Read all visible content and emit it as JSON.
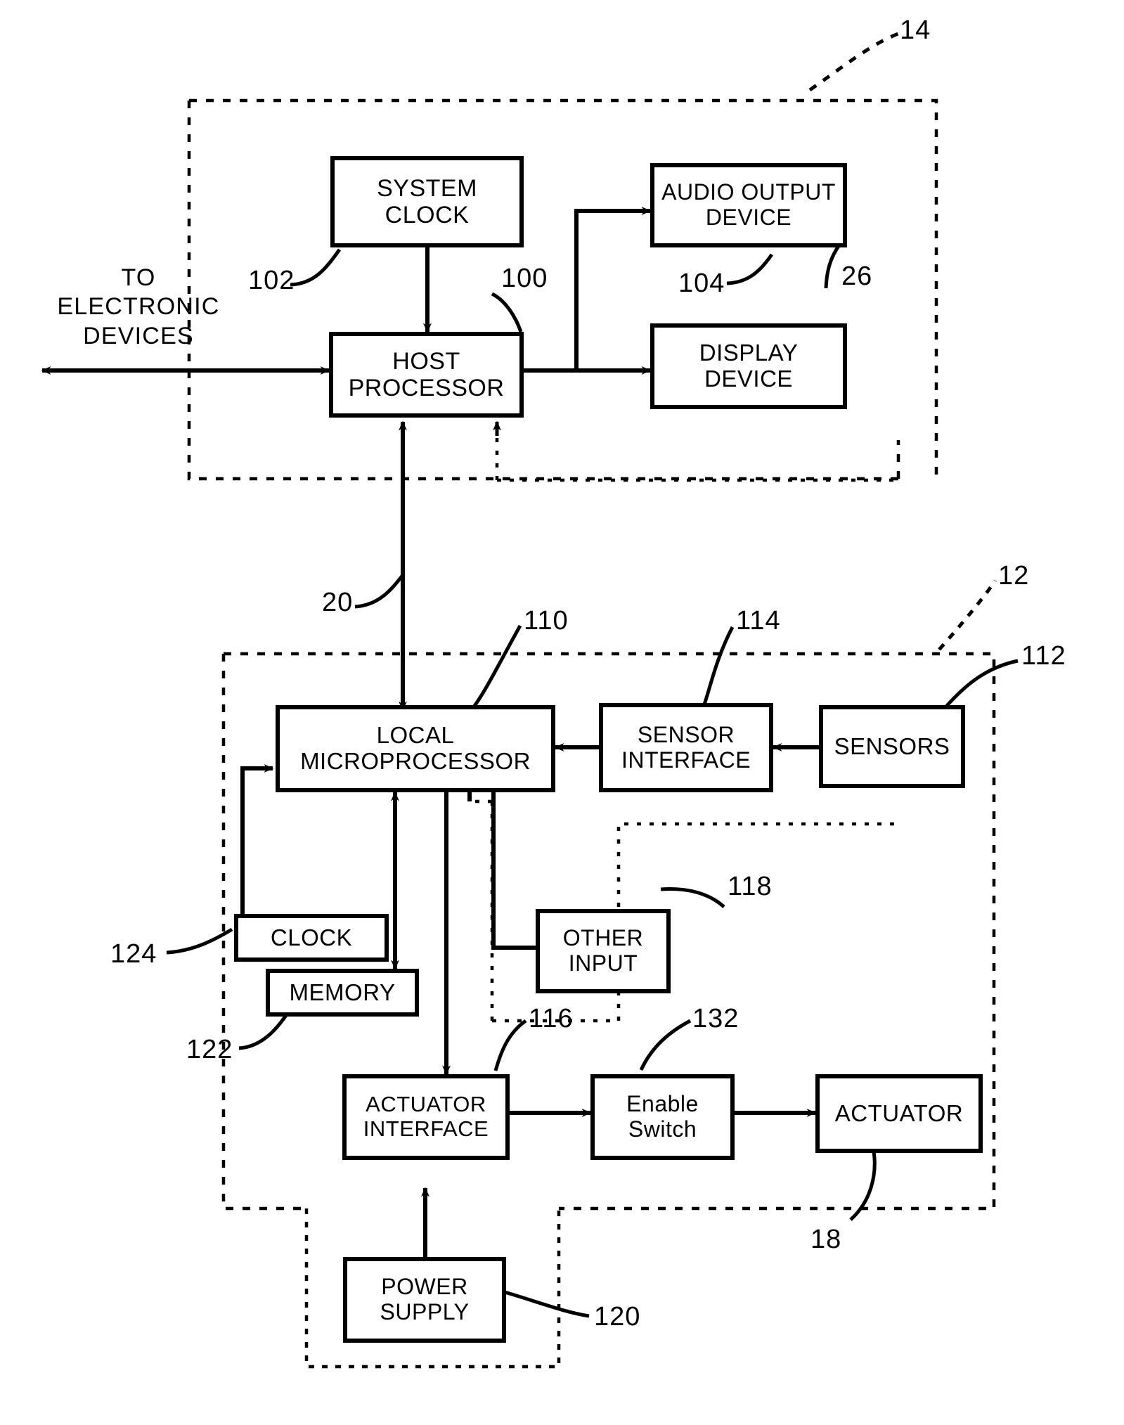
{
  "figure": {
    "type": "patent-block-diagram",
    "background_color": "#ffffff",
    "line_color": "#000000"
  },
  "labels": {
    "to_electronic_devices": "TO\nELECTRONIC\nDEVICES"
  },
  "blocks": [
    {
      "id": "system-clock",
      "lines": [
        "SYSTEM",
        "CLOCK"
      ],
      "ref": "102"
    },
    {
      "id": "audio-output-device",
      "lines": [
        "AUDIO OUTPUT",
        "DEVICE"
      ],
      "ref": "104"
    },
    {
      "id": "host-processor",
      "lines": [
        "HOST",
        "PROCESSOR"
      ],
      "ref": "100"
    },
    {
      "id": "display-device",
      "lines": [
        "DISPLAY",
        "DEVICE"
      ],
      "ref": "26"
    },
    {
      "id": "local-microprocessor",
      "lines": [
        "LOCAL",
        "MICROPROCESSOR"
      ],
      "ref": "110"
    },
    {
      "id": "sensor-interface",
      "lines": [
        "SENSOR",
        "INTERFACE"
      ],
      "ref": "114"
    },
    {
      "id": "sensors",
      "lines": [
        "SENSORS"
      ],
      "ref": "112"
    },
    {
      "id": "clock",
      "lines": [
        "CLOCK"
      ],
      "ref": "124"
    },
    {
      "id": "memory",
      "lines": [
        "MEMORY"
      ],
      "ref": "122"
    },
    {
      "id": "other-input",
      "lines": [
        "OTHER",
        "INPUT"
      ],
      "ref": "118"
    },
    {
      "id": "actuator-interface",
      "lines": [
        "ACTUATOR",
        "INTERFACE"
      ],
      "ref": "116"
    },
    {
      "id": "enable-switch",
      "lines": [
        "Enable",
        "Switch"
      ],
      "ref": "132"
    },
    {
      "id": "actuator",
      "lines": [
        "ACTUATOR"
      ],
      "ref": "18"
    },
    {
      "id": "power-supply",
      "lines": [
        "POWER",
        "SUPPLY"
      ],
      "ref": "120"
    }
  ],
  "reference_numerals": {
    "host_system_enclosure": "14",
    "host_processor": "100",
    "system_clock": "102",
    "audio_output_device": "104",
    "display_device": "26",
    "interface_bus": "20",
    "interface_device_enclosure": "12",
    "local_microprocessor": "110",
    "sensors": "112",
    "sensor_interface": "114",
    "actuator_interface": "116",
    "other_input": "118",
    "power_supply": "120",
    "memory": "122",
    "clock": "124",
    "enable_switch": "132",
    "actuator": "18"
  }
}
